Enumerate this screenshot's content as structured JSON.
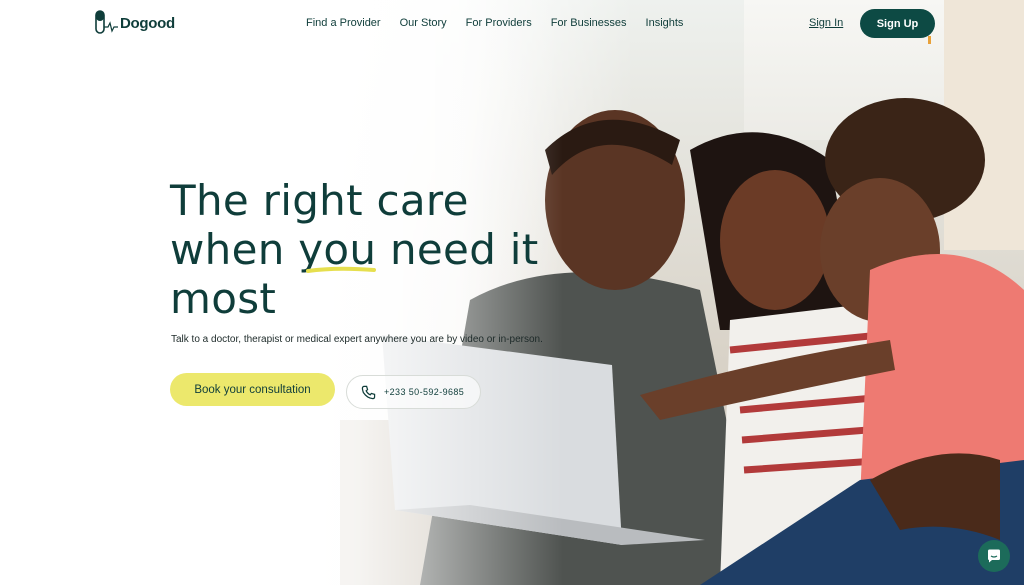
{
  "brand": {
    "name": "Dogood"
  },
  "nav": {
    "links": [
      "Find a Provider",
      "Our Story",
      "For Providers",
      "For Businesses",
      "Insights"
    ],
    "sign_in": "Sign In",
    "sign_up": "Sign Up"
  },
  "hero": {
    "headline_line1": "The right care",
    "headline_line2": "when you need it",
    "headline_line3": "most",
    "subtitle": "Talk to a doctor, therapist or medical expert anywhere you are by video or in-person.",
    "cta_primary": "Book your consultation",
    "phone": "+233 50-592-9685"
  },
  "icons": {
    "logo": "pill-logo-icon",
    "phone": "phone-icon",
    "chat": "chat-icon"
  },
  "colors": {
    "brand_dark": "#0d4a44",
    "cta_yellow": "#ece86c",
    "chat_green": "#1c6b5a"
  }
}
